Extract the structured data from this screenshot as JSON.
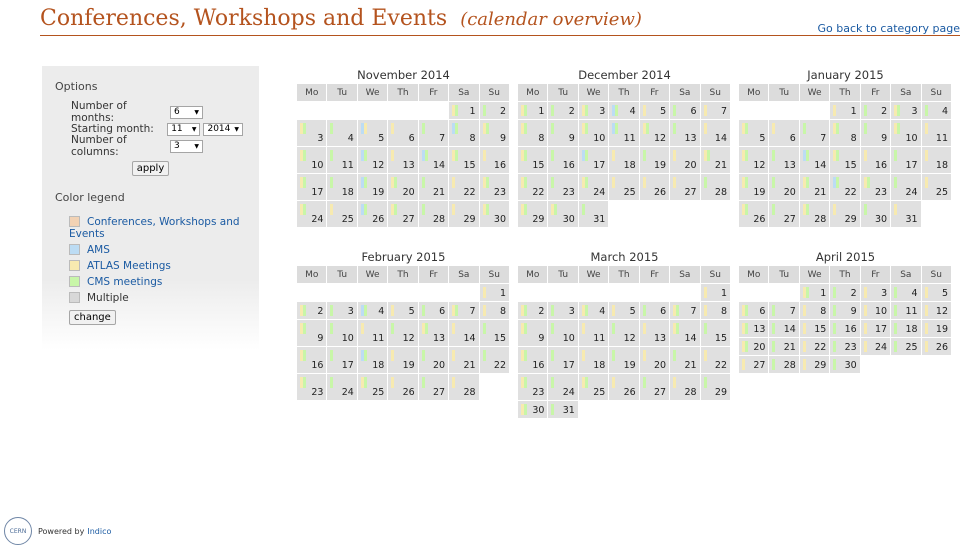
{
  "header": {
    "title": "Conferences, Workshops and Events",
    "subtitle": "(calendar overview)",
    "back_link": "Go back to category page"
  },
  "options": {
    "heading": "Options",
    "months_label": "Number of months:",
    "months_value": "6",
    "start_label": "Starting month:",
    "start_month_value": "11",
    "start_year_value": "2014",
    "columns_label": "Number of columns:",
    "columns_value": "3",
    "apply_label": "apply"
  },
  "legend": {
    "heading": "Color legend",
    "items": [
      {
        "label": "Conferences, Workshops and Events",
        "color": "#f2d2b4",
        "link": true
      },
      {
        "label": "AMS",
        "color": "#bcdcf4",
        "link": true
      },
      {
        "label": "ATLAS Meetings",
        "color": "#f7eab0",
        "link": true
      },
      {
        "label": "CMS meetings",
        "color": "#c8f6a8",
        "link": true
      },
      {
        "label": "Multiple",
        "color": "#d8d8d8",
        "link": false
      }
    ],
    "change_label": "change"
  },
  "event_colors": {
    "conferences": "#f2d2b4",
    "ams": "#bcdcf4",
    "atlas": "#f7eab0",
    "cms": "#c8f6a8"
  },
  "weekdays": [
    "Mo",
    "Tu",
    "We",
    "Th",
    "Fr",
    "Sa",
    "Su"
  ],
  "months": [
    {
      "title": "November 2014",
      "offset": 5,
      "days": 30,
      "tall_rows": [
        1,
        2,
        3,
        4
      ],
      "events": {
        "3": [
          "atlas",
          "cms"
        ],
        "4": [
          "cms"
        ],
        "5": [
          "ams",
          "atlas"
        ],
        "6": [
          "atlas"
        ],
        "7": [
          "cms"
        ],
        "8": [
          "ams",
          "cms"
        ],
        "9": [
          "atlas",
          "cms"
        ],
        "10": [
          "atlas",
          "cms"
        ],
        "11": [
          "cms"
        ],
        "12": [
          "ams",
          "cms"
        ],
        "13": [
          "atlas"
        ],
        "14": [
          "ams",
          "cms"
        ],
        "15": [
          "atlas",
          "cms"
        ],
        "16": [
          "atlas"
        ],
        "17": [
          "atlas",
          "cms"
        ],
        "18": [
          "cms"
        ],
        "19": [
          "ams",
          "cms"
        ],
        "20": [
          "atlas",
          "cms"
        ],
        "21": [
          "cms"
        ],
        "22": [
          "atlas"
        ],
        "23": [
          "atlas",
          "cms"
        ],
        "24": [
          "atlas",
          "cms"
        ],
        "25": [
          "atlas"
        ],
        "26": [
          "ams",
          "cms"
        ],
        "27": [
          "atlas",
          "cms"
        ],
        "28": [
          "cms"
        ],
        "29": [
          "atlas"
        ],
        "30": [
          "atlas",
          "cms"
        ],
        "1": [
          "atlas",
          "cms"
        ],
        "2": [
          "cms"
        ]
      }
    },
    {
      "title": "December 2014",
      "offset": 0,
      "days": 31,
      "tall_rows": [
        1,
        2,
        3,
        4
      ],
      "events": {
        "1": [
          "atlas",
          "cms"
        ],
        "2": [
          "cms"
        ],
        "3": [
          "atlas",
          "cms"
        ],
        "4": [
          "ams",
          "cms"
        ],
        "5": [
          "atlas"
        ],
        "6": [
          "cms"
        ],
        "7": [
          "atlas"
        ],
        "8": [
          "atlas",
          "cms"
        ],
        "9": [
          "cms"
        ],
        "10": [
          "atlas",
          "cms"
        ],
        "11": [
          "ams",
          "cms"
        ],
        "12": [
          "atlas",
          "cms"
        ],
        "13": [
          "cms"
        ],
        "14": [
          "atlas"
        ],
        "15": [
          "atlas",
          "cms"
        ],
        "16": [
          "cms"
        ],
        "17": [
          "ams",
          "cms"
        ],
        "18": [
          "atlas"
        ],
        "19": [
          "cms"
        ],
        "20": [
          "atlas"
        ],
        "21": [
          "atlas",
          "cms"
        ],
        "22": [
          "atlas",
          "cms"
        ],
        "23": [
          "cms"
        ],
        "24": [
          "atlas",
          "cms"
        ],
        "25": [
          "atlas"
        ],
        "26": [
          "atlas"
        ],
        "27": [
          "atlas"
        ],
        "28": [
          "cms"
        ],
        "29": [
          "atlas",
          "cms"
        ],
        "30": [
          "atlas",
          "cms"
        ],
        "31": [
          "cms"
        ]
      }
    },
    {
      "title": "January 2015",
      "offset": 3,
      "days": 31,
      "tall_rows": [
        1,
        2,
        3,
        4
      ],
      "events": {
        "1": [
          "atlas"
        ],
        "2": [
          "cms"
        ],
        "3": [
          "atlas",
          "cms"
        ],
        "4": [
          "cms"
        ],
        "5": [
          "atlas",
          "cms"
        ],
        "6": [
          "atlas"
        ],
        "7": [
          "cms"
        ],
        "8": [
          "atlas",
          "cms"
        ],
        "9": [
          "cms"
        ],
        "10": [
          "atlas",
          "cms"
        ],
        "11": [
          "atlas"
        ],
        "12": [
          "atlas",
          "cms"
        ],
        "13": [
          "cms"
        ],
        "14": [
          "ams",
          "cms"
        ],
        "15": [
          "atlas",
          "cms"
        ],
        "16": [
          "atlas"
        ],
        "17": [
          "cms"
        ],
        "18": [
          "atlas"
        ],
        "19": [
          "atlas",
          "cms"
        ],
        "20": [
          "cms"
        ],
        "21": [
          "atlas",
          "cms"
        ],
        "22": [
          "ams",
          "cms"
        ],
        "23": [
          "atlas",
          "cms"
        ],
        "24": [
          "cms"
        ],
        "25": [
          "atlas"
        ],
        "26": [
          "atlas",
          "cms"
        ],
        "27": [
          "cms"
        ],
        "28": [
          "atlas",
          "cms"
        ],
        "29": [
          "atlas"
        ],
        "30": [
          "cms"
        ],
        "31": [
          "atlas"
        ]
      }
    },
    {
      "title": "February 2015",
      "offset": 6,
      "days": 28,
      "tall_rows": [
        2,
        3,
        4
      ],
      "events": {
        "1": [
          "atlas"
        ],
        "2": [
          "atlas",
          "cms"
        ],
        "3": [
          "cms"
        ],
        "4": [
          "ams",
          "cms"
        ],
        "5": [
          "atlas"
        ],
        "6": [
          "cms"
        ],
        "7": [
          "atlas",
          "cms"
        ],
        "8": [
          "atlas"
        ],
        "9": [
          "atlas",
          "cms"
        ],
        "10": [
          "cms"
        ],
        "11": [
          "atlas"
        ],
        "12": [
          "cms"
        ],
        "13": [
          "atlas",
          "cms"
        ],
        "14": [
          "atlas"
        ],
        "15": [
          "cms"
        ],
        "16": [
          "atlas",
          "cms"
        ],
        "17": [
          "cms"
        ],
        "18": [
          "ams",
          "cms"
        ],
        "19": [
          "atlas"
        ],
        "20": [
          "cms"
        ],
        "21": [
          "atlas"
        ],
        "22": [
          "cms"
        ],
        "23": [
          "atlas",
          "cms"
        ],
        "24": [
          "cms"
        ],
        "25": [
          "atlas",
          "cms"
        ],
        "26": [
          "atlas"
        ],
        "27": [
          "cms"
        ],
        "28": [
          "atlas"
        ]
      }
    },
    {
      "title": "March 2015",
      "offset": 6,
      "days": 31,
      "tall_rows": [
        2,
        3,
        4
      ],
      "events": {
        "1": [
          "atlas"
        ],
        "2": [
          "atlas",
          "cms"
        ],
        "3": [
          "cms"
        ],
        "4": [
          "atlas",
          "cms"
        ],
        "5": [
          "atlas"
        ],
        "6": [
          "cms"
        ],
        "7": [
          "atlas",
          "cms"
        ],
        "8": [
          "atlas"
        ],
        "9": [
          "atlas",
          "cms"
        ],
        "10": [
          "cms"
        ],
        "11": [
          "atlas"
        ],
        "12": [
          "cms"
        ],
        "13": [
          "atlas"
        ],
        "14": [
          "atlas",
          "cms"
        ],
        "15": [
          "cms"
        ],
        "16": [
          "atlas",
          "cms"
        ],
        "17": [
          "cms"
        ],
        "18": [
          "atlas"
        ],
        "19": [
          "cms"
        ],
        "20": [
          "atlas"
        ],
        "21": [
          "cms"
        ],
        "22": [
          "atlas"
        ],
        "23": [
          "atlas",
          "cms"
        ],
        "24": [
          "cms"
        ],
        "25": [
          "atlas",
          "cms"
        ],
        "26": [
          "atlas"
        ],
        "27": [
          "cms"
        ],
        "28": [
          "atlas"
        ],
        "29": [
          "cms"
        ],
        "30": [
          "atlas",
          "cms"
        ],
        "31": [
          "cms"
        ]
      }
    },
    {
      "title": "April 2015",
      "offset": 2,
      "days": 30,
      "tall_rows": [],
      "events": {
        "1": [
          "atlas",
          "cms"
        ],
        "2": [
          "cms"
        ],
        "3": [
          "atlas"
        ],
        "4": [
          "cms"
        ],
        "5": [
          "atlas"
        ],
        "6": [
          "atlas",
          "cms"
        ],
        "7": [
          "cms"
        ],
        "8": [
          "atlas"
        ],
        "9": [
          "cms"
        ],
        "10": [
          "atlas"
        ],
        "11": [
          "cms"
        ],
        "12": [
          "atlas"
        ],
        "13": [
          "atlas",
          "cms"
        ],
        "14": [
          "cms"
        ],
        "15": [
          "atlas"
        ],
        "16": [
          "cms"
        ],
        "17": [
          "atlas"
        ],
        "18": [
          "cms"
        ],
        "19": [
          "atlas"
        ],
        "20": [
          "atlas",
          "cms"
        ],
        "21": [
          "cms"
        ],
        "22": [
          "atlas"
        ],
        "23": [
          "cms"
        ],
        "24": [
          "atlas"
        ],
        "25": [
          "cms"
        ],
        "26": [
          "atlas"
        ],
        "27": [
          "atlas"
        ],
        "28": [
          "cms"
        ],
        "29": [
          "atlas"
        ],
        "30": [
          "cms"
        ]
      }
    }
  ],
  "footer": {
    "powered_by": "Powered by",
    "link": "Indico",
    "logo_text": "CERN"
  }
}
